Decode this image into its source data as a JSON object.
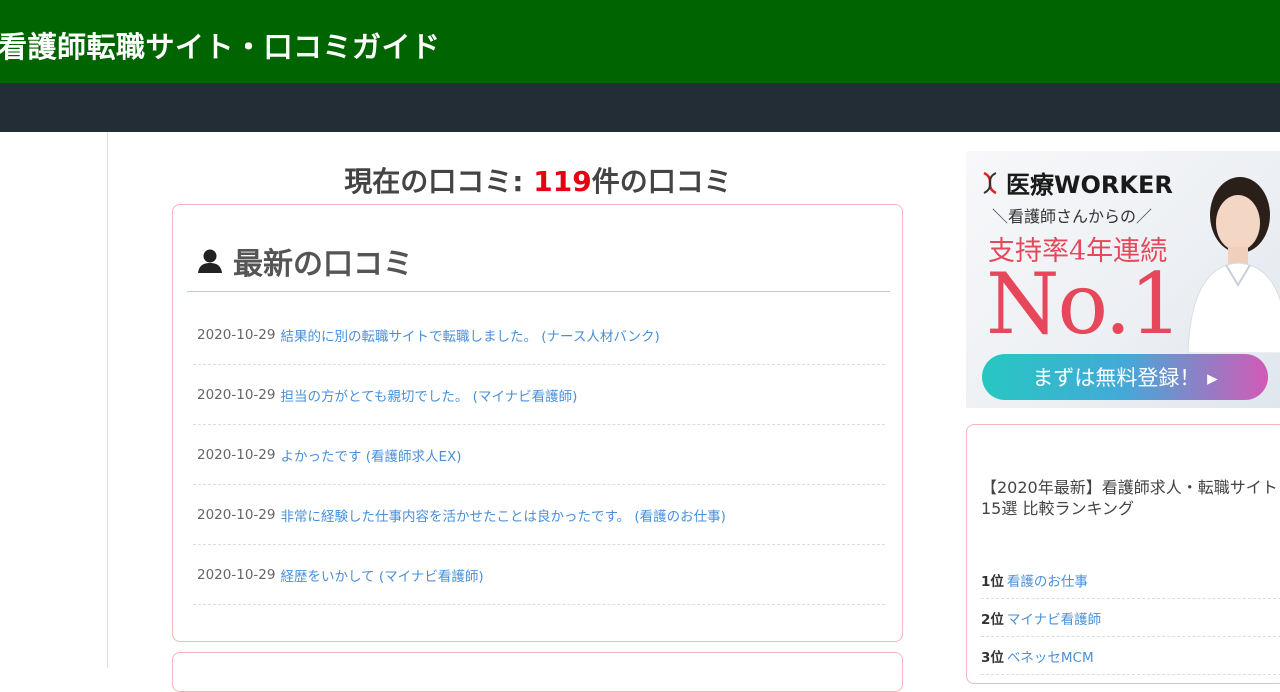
{
  "header": {
    "site_title": "看護師転職サイト・口コミガイド"
  },
  "main": {
    "count_prefix": "現在の口コミ: ",
    "count_number": "119",
    "count_suffix": "件の口コミ",
    "latest_title": "最新の口コミ",
    "reviews": [
      {
        "date": "2020-10-29",
        "text": "結果的に別の転職サイトで転職しました。 (ナース人材バンク)"
      },
      {
        "date": "2020-10-29",
        "text": "担当の方がとても親切でした。 (マイナビ看護師)"
      },
      {
        "date": "2020-10-29",
        "text": "よかったです (看護師求人EX)"
      },
      {
        "date": "2020-10-29",
        "text": "非常に経験した仕事内容を活かせたことは良かったです。 (看護のお仕事)"
      },
      {
        "date": "2020-10-29",
        "text": "経歴をいかして (マイナビ看護師)"
      }
    ]
  },
  "ad": {
    "logo": "医療WORKER",
    "sub": "＼看護師さんからの／",
    "support": "支持率4年連続",
    "headline": "No.1",
    "cta": "まずは無料登録！ ▸"
  },
  "sidebar": {
    "ranking_title": "【2020年最新】看護師求人・転職サイト15選 比較ランキング",
    "ranking": [
      {
        "rank": "1位",
        "name": "看護のお仕事"
      },
      {
        "rank": "2位",
        "name": "マイナビ看護師"
      },
      {
        "rank": "3位",
        "name": "ベネッセMCM"
      }
    ]
  },
  "colors": {
    "header_bg": "#006400",
    "nav_bg": "#232d35",
    "accent_count": "#e50012",
    "link": "#4a90d9",
    "box_border": "#f0b8b8"
  },
  "icons": {
    "latest_title_icon": "user-icon"
  }
}
